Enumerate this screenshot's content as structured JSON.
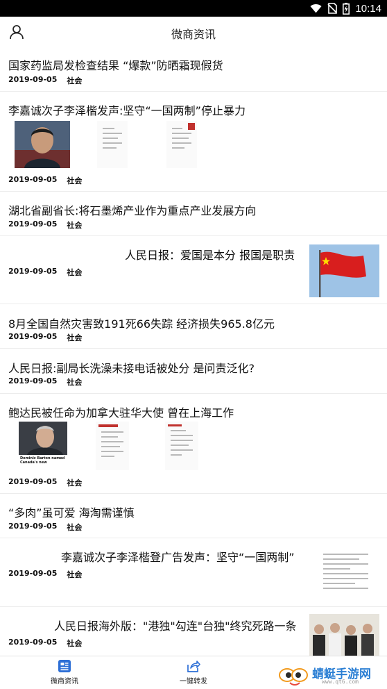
{
  "status": {
    "time": "10:14",
    "icons": [
      "wifi-icon",
      "no-sim-icon",
      "battery-charging-icon"
    ]
  },
  "appbar": {
    "title": "微商资讯",
    "left_icon": "user-icon"
  },
  "feed": [
    {
      "title": "国家药监局发检查结果 “爆款”防晒霜现假货",
      "date": "2019-09-05",
      "tag": "社会"
    },
    {
      "title": "李嘉诚次子李泽楷发声:坚守“一国两制”停止暴力",
      "date": "2019-09-05",
      "tag": "社会"
    },
    {
      "title": "湖北省副省长:将石墨烯产业作为重点产业发展方向",
      "date": "2019-09-05",
      "tag": "社会"
    },
    {
      "title": "人民日报：爱国是本分 报国是职责",
      "date": "2019-09-05",
      "tag": "社会"
    },
    {
      "title": "8月全国自然灾害致191死66失踪 经济损失965.8亿元",
      "date": "2019-09-05",
      "tag": "社会"
    },
    {
      "title": "人民日报:副局长洗澡未接电话被处分 是问责泛化?",
      "date": "2019-09-05",
      "tag": "社会"
    },
    {
      "title": "鲍达民被任命为加拿大驻华大使 曾在上海工作",
      "date": "2019-09-05",
      "tag": "社会"
    },
    {
      "title": "“多肉”虽可爱 海淘需谨慎",
      "date": "2019-09-05",
      "tag": "社会"
    },
    {
      "title": "李嘉诚次子李泽楷登广告发声：坚守“一国两制”",
      "date": "2019-09-05",
      "tag": "社会"
    },
    {
      "title": "人民日报海外版：\"港独\"勾连\"台独\"终究死路一条",
      "date": "2019-09-05",
      "tag": "社会"
    }
  ],
  "image_captions": {
    "newspaper_caption": "Dominic Barton named Canada's new ambassador to China"
  },
  "bottom_nav": [
    {
      "label": "微商资讯",
      "icon": "news-icon",
      "active": true
    },
    {
      "label": "一键转发",
      "icon": "share-icon",
      "active": false
    }
  ],
  "watermark": {
    "name": "蜻蜓手游网",
    "url": "www.qt6.com"
  },
  "colors": {
    "accent": "#2d6fd6",
    "status_bar": "#000000",
    "divider": "#ececec"
  }
}
